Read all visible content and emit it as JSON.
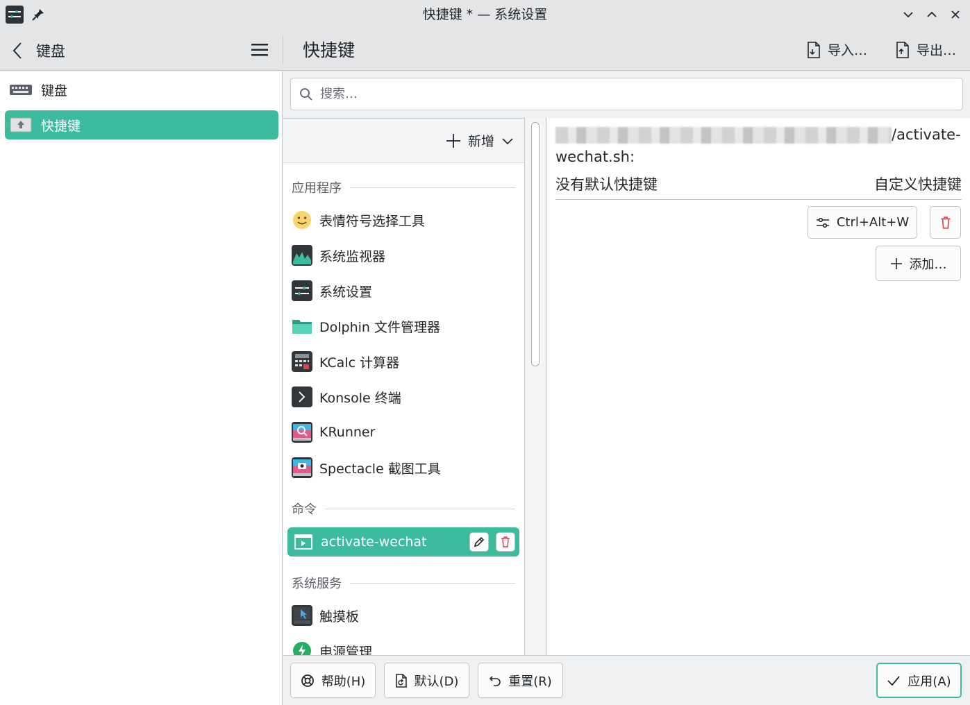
{
  "window": {
    "title": "快捷键 * — 系统设置"
  },
  "header": {
    "back_label": "键盘",
    "page_title": "快捷键",
    "import_label": "导入…",
    "export_label": "导出…"
  },
  "sidebar": {
    "items": [
      {
        "label": "键盘",
        "icon": "keyboard-icon",
        "active": false
      },
      {
        "label": "快捷键",
        "icon": "shortcuts-icon",
        "active": true
      }
    ]
  },
  "search": {
    "placeholder": "搜索…",
    "value": ""
  },
  "list": {
    "new_label": "新增",
    "sections": [
      {
        "title": "应用程序",
        "items": [
          {
            "label": "表情符号选择工具",
            "icon": "emoji-icon"
          },
          {
            "label": "系统监视器",
            "icon": "system-monitor-icon"
          },
          {
            "label": "系统设置",
            "icon": "system-settings-icon"
          },
          {
            "label": "Dolphin 文件管理器",
            "icon": "folder-icon"
          },
          {
            "label": "KCalc 计算器",
            "icon": "calculator-icon"
          },
          {
            "label": "Konsole 终端",
            "icon": "terminal-icon"
          },
          {
            "label": "KRunner",
            "icon": "krunner-icon"
          },
          {
            "label": "Spectacle 截图工具",
            "icon": "screenshot-icon"
          }
        ]
      },
      {
        "title": "命令",
        "items": [
          {
            "label": "activate-wechat",
            "icon": "script-icon",
            "selected": true
          }
        ]
      },
      {
        "title": "系统服务",
        "items": [
          {
            "label": "触摸板",
            "icon": "touchpad-icon"
          },
          {
            "label": "电源管理",
            "icon": "power-icon"
          }
        ]
      }
    ]
  },
  "detail": {
    "path_suffix": "/activate-",
    "path_line2": "wechat.sh:",
    "no_default": "没有默认快捷键",
    "custom_label": "自定义快捷键",
    "shortcut": "Ctrl+Alt+W",
    "add_label": "添加…"
  },
  "footer": {
    "help": "帮助(H)",
    "defaults": "默认(D)",
    "reset": "重置(R)",
    "apply": "应用(A)"
  },
  "colors": {
    "accent": "#3dbb9e",
    "delete": "#da4453"
  }
}
